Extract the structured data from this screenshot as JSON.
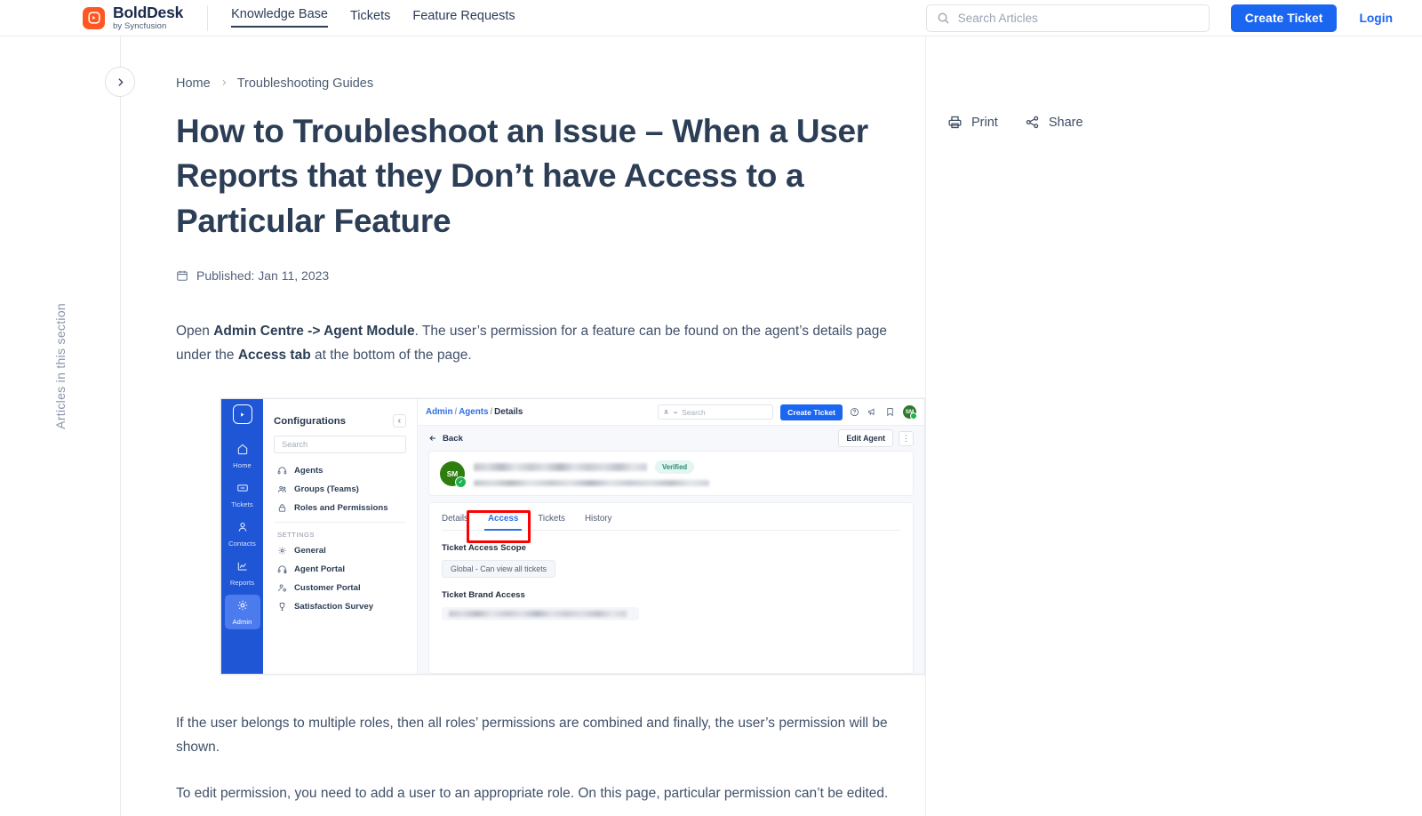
{
  "header": {
    "logo": {
      "brand_bold": "Bold",
      "brand_light": "Desk",
      "tagline": "by Syncfusion",
      "icon": "speech-bubble-icon",
      "accent": "#ff5722"
    },
    "nav": [
      {
        "label": "Knowledge Base",
        "active": true
      },
      {
        "label": "Tickets",
        "active": false
      },
      {
        "label": "Feature Requests",
        "active": false
      }
    ],
    "search": {
      "placeholder": "Search Articles",
      "value": "",
      "icon": "search-icon"
    },
    "create_ticket_label": "Create Ticket",
    "login_label": "Login",
    "primary_color": "#1a66f0"
  },
  "left_rail": {
    "vertical_label": "Articles in this section",
    "toggle_icon": "chevron-right-icon"
  },
  "breadcrumb": {
    "home": "Home",
    "separator": "›",
    "current": "Troubleshooting Guides"
  },
  "article": {
    "title": "How to Troubleshoot an Issue – When a User Reports that they Don’t have Access to a Particular Feature",
    "published_label": "Published: Jan 11, 2023",
    "calendar_icon": "calendar-icon",
    "paragraph1": {
      "p1": "Open ",
      "b1": "Admin Centre -> Agent Module",
      "p2": ". The user’s permission for a feature can be found on the agent’s details page under the ",
      "b2": "Access tab",
      "p3": " at the bottom of the page."
    },
    "paragraph2": "If the user belongs to multiple roles, then all roles’ permissions are combined and finally, the user’s permission will be shown.",
    "paragraph3": "To edit permission, you need to add a user to an appropriate role. On this page, particular permission can’t be edited."
  },
  "page_actions": [
    {
      "label": "Print",
      "icon": "printer-icon"
    },
    {
      "label": "Share",
      "icon": "share-icon"
    }
  ],
  "embedded_screenshot": {
    "sidebar": {
      "logo_icon": "boldesk-mark-icon",
      "items": [
        {
          "label": "Home",
          "icon": "home-icon",
          "active": false
        },
        {
          "label": "Tickets",
          "icon": "ticket-icon",
          "active": false
        },
        {
          "label": "Contacts",
          "icon": "person-icon",
          "active": false
        },
        {
          "label": "Reports",
          "icon": "chart-icon",
          "active": false
        },
        {
          "label": "Admin",
          "icon": "gear-icon",
          "active": true
        }
      ]
    },
    "configurations": {
      "title": "Configurations",
      "collapse_icon": "chevron-left-icon",
      "search_placeholder": "Search",
      "items": [
        {
          "label": "Agents",
          "icon": "headset-icon"
        },
        {
          "label": "Groups (Teams)",
          "icon": "group-icon"
        },
        {
          "label": "Roles and Permissions",
          "icon": "lock-icon"
        }
      ],
      "group_label": "SETTINGS",
      "settings_items": [
        {
          "label": "General",
          "icon": "gear-icon"
        },
        {
          "label": "Agent Portal",
          "icon": "headset-gear-icon"
        },
        {
          "label": "Customer Portal",
          "icon": "person-gear-icon"
        },
        {
          "label": "Satisfaction Survey",
          "icon": "award-icon"
        }
      ]
    },
    "topbar": {
      "breadcrumb": {
        "first": "Admin",
        "second": "Agents",
        "current": "Details",
        "sep": "/"
      },
      "search_placeholder": "Search",
      "search_icon": "person-dropdown-icon",
      "create_ticket_label": "Create Ticket",
      "icons": [
        "help-icon",
        "announcement-icon",
        "bookmark-icon"
      ],
      "avatar_initials": "SM"
    },
    "actions": {
      "back_label": "Back",
      "back_icon": "arrow-left-icon",
      "edit_label": "Edit Agent",
      "kebab_icon": "kebab-menu-icon"
    },
    "agent_card": {
      "avatar_initials": "SM",
      "name_redacted": true,
      "email_redacted": true,
      "badge": "Verified"
    },
    "tabs": [
      {
        "label": "Details",
        "active": false
      },
      {
        "label": "Access",
        "active": true,
        "annotated": true
      },
      {
        "label": "Tickets",
        "active": false
      },
      {
        "label": "History",
        "active": false
      }
    ],
    "sections": [
      {
        "label": "Ticket Access Scope",
        "value": "Global - Can view all tickets",
        "redacted": false
      },
      {
        "label": "Ticket Brand Access",
        "value": "",
        "redacted": true
      }
    ],
    "annotation_color": "#ff0000"
  }
}
